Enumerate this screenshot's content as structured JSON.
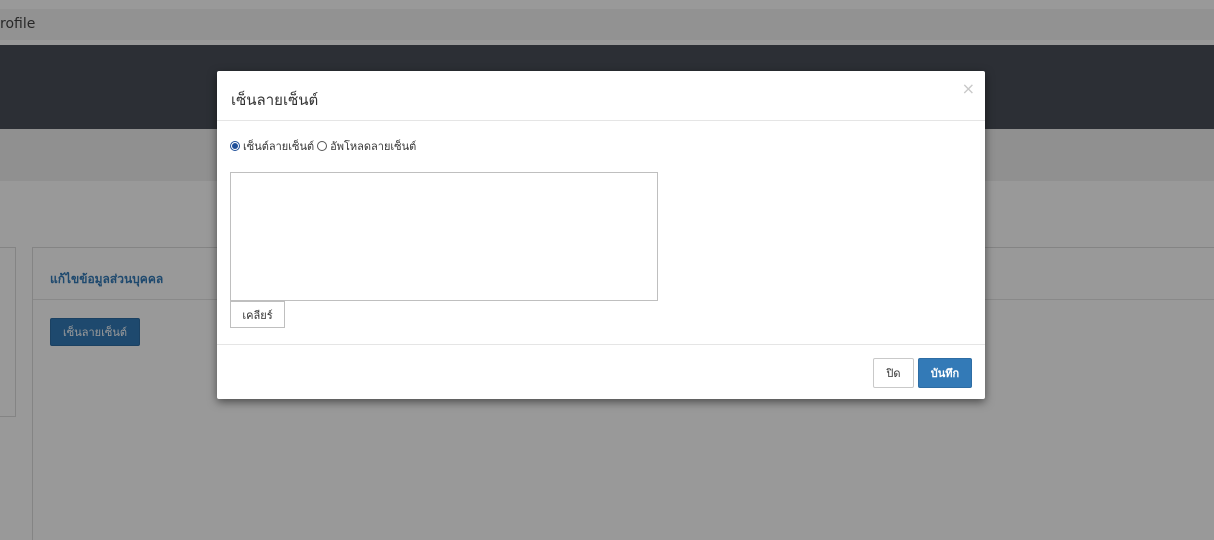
{
  "browser": {
    "tab_title": "rofile"
  },
  "page": {
    "card_title": "แก้ไขข้อมูลส่วนบุคคล",
    "sign_button_label": "เซ็นลายเซ็นต์"
  },
  "modal": {
    "title": "เซ็นลายเซ็นต์",
    "close_glyph": "×",
    "options": [
      {
        "label": "เซ็นต์ลายเซ็นต์",
        "checked": true
      },
      {
        "label": "อัพโหลดลายเซ็นต์",
        "checked": false
      }
    ],
    "clear_label": "เคลียร์",
    "footer": {
      "close_label": "ปิด",
      "save_label": "บันทึก"
    }
  },
  "colors": {
    "primary": "#337ab7",
    "nav": "#4a4f59",
    "backdrop": "rgba(0,0,0,0.4)"
  }
}
